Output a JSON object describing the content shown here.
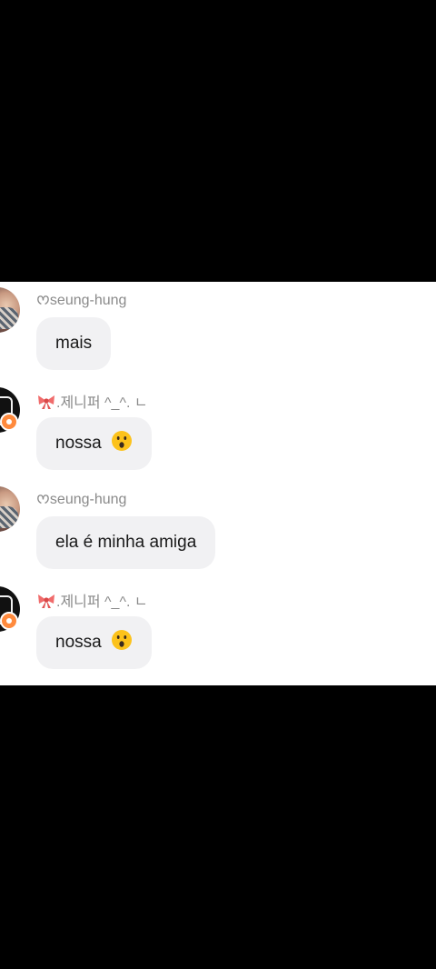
{
  "messages": [
    {
      "user": "ᰔseung-hung",
      "text": "mais",
      "emoji": ""
    },
    {
      "user": ".제니퍼 ^_^. ㄴ",
      "user_icon": "ribbon-icon",
      "text": "nossa",
      "emoji": "astonished-face"
    },
    {
      "user": "ᰔseung-hung",
      "text": "ela é minha amiga",
      "emoji": ""
    },
    {
      "user": ".제니퍼 ^_^. ㄴ",
      "user_icon": "ribbon-icon",
      "text": "nossa",
      "emoji": "astonished-face"
    }
  ],
  "colors": {
    "bubble": "#f1f1f3",
    "username": "#8a8a8a",
    "badge": "#ff8a3d",
    "ribbon": "#f06b6b"
  }
}
